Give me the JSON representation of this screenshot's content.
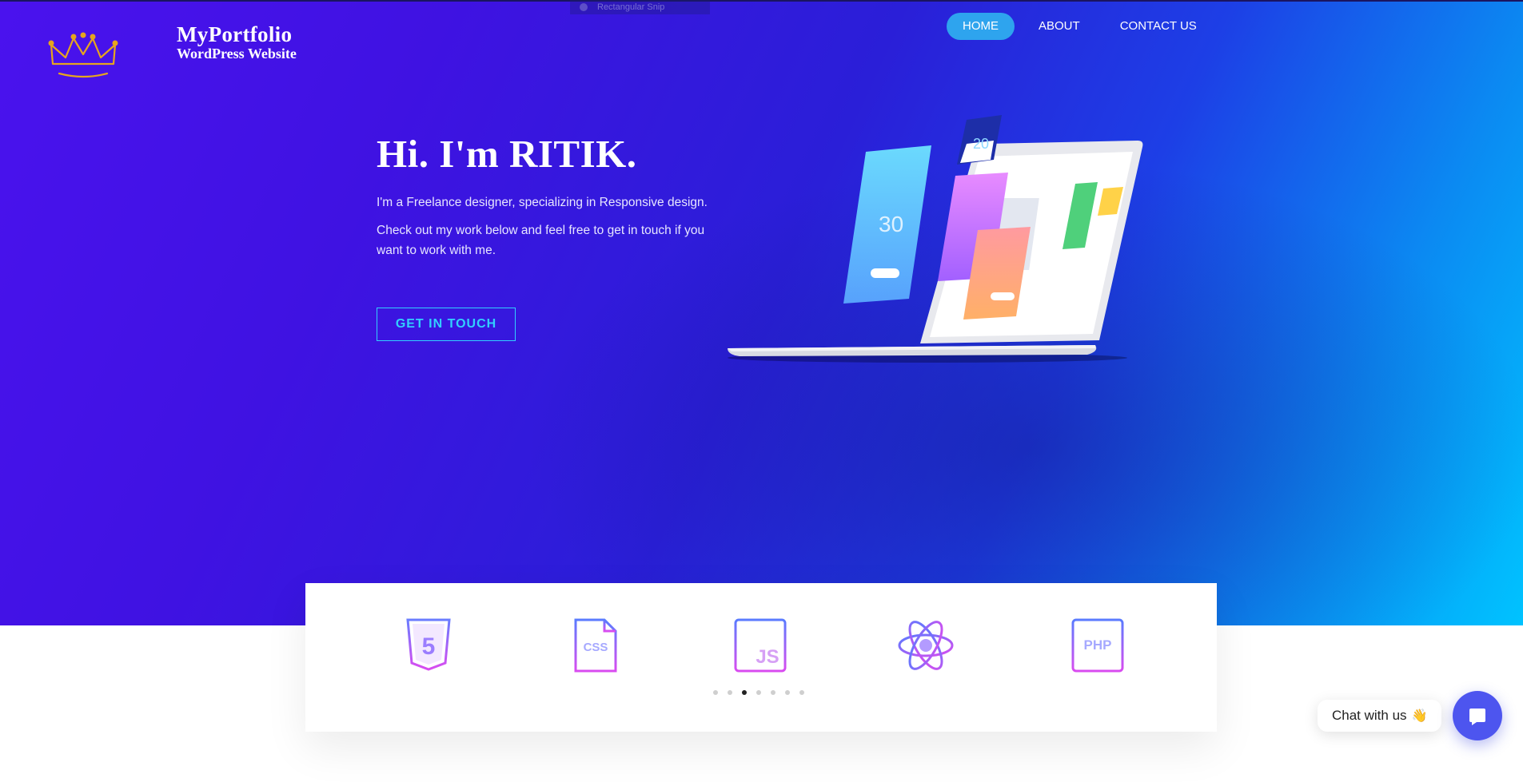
{
  "system": {
    "snip_label": "Rectangular Snip"
  },
  "brand": {
    "line1": "MyPortfolio",
    "line2": "WordPress Website"
  },
  "nav": [
    {
      "label": "HOME",
      "active": true
    },
    {
      "label": "ABOUT",
      "active": false
    },
    {
      "label": "CONTACT US",
      "active": false
    }
  ],
  "hero": {
    "title": "Hi. I'm RITIK.",
    "subtitle": "I'm a Freelance designer, specializing in Responsive design.",
    "body": "Check out my work below and feel free to get in touch if you want to work with me.",
    "cta_label": "GET IN TOUCH"
  },
  "skills": {
    "items": [
      {
        "icon": "html5-icon",
        "text": "5"
      },
      {
        "icon": "css-file-icon",
        "text": "CSS"
      },
      {
        "icon": "js-icon",
        "text": "JS"
      },
      {
        "icon": "react-atom-icon",
        "text": ""
      },
      {
        "icon": "php-icon",
        "text": "PHP"
      }
    ],
    "pagination": {
      "count": 7,
      "active_index": 2
    }
  },
  "chat": {
    "label": "Chat with us",
    "wave": "👋"
  },
  "colors": {
    "accent_cyan": "#31d0ff",
    "nav_active": "#2ea4ee",
    "chat_button": "#4d55ef",
    "crown_gold": "#e6a51e"
  }
}
